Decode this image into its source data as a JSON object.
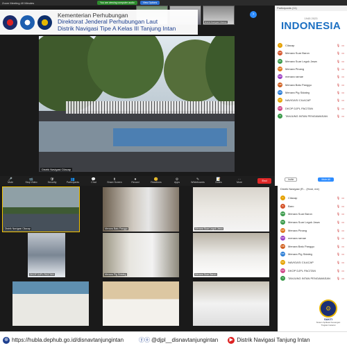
{
  "window": {
    "title": "Zoom Meeting  40 Minutes",
    "recording_label": "You are viewing computer audio",
    "view_label": "View Options"
  },
  "header": {
    "line1": "Kementerian Perhubungan",
    "line2": "Direktorat Jenderal Perhubungan Laut",
    "line3": "Distrik Navigasi Tipe A Kelas III Tanjung Intan"
  },
  "thumbnails": [
    "Distrik Navigasi Tipe",
    "",
    "Distrik Navigasi Cilacap",
    ""
  ],
  "main_video": {
    "label": "Distrik Navigasi Cilacap"
  },
  "panel": {
    "title": "Participants (11)",
    "badge": {
      "dates": "1945          2023",
      "word": "INDONESIA"
    },
    "participants": [
      {
        "name": "Cilacap",
        "color": "#e5a100",
        "initials": "C"
      },
      {
        "name": "Menara Suar Baron",
        "color": "#d4542a",
        "initials": "MS"
      },
      {
        "name": "Menara Suar Legok Jawa",
        "color": "#3a9a4a",
        "initials": "ML"
      },
      {
        "name": "Menara Pinang",
        "color": "#e07820",
        "initials": "MP"
      },
      {
        "name": "menara ramae",
        "color": "#9b3fc4",
        "initials": "MR"
      },
      {
        "name": "Menara Batu Panggu",
        "color": "#d06020",
        "initials": "MB"
      },
      {
        "name": "Menara Pig Sidaleg",
        "color": "#2e7fd6",
        "initials": "MS"
      },
      {
        "name": "NAVIGASI CILACAP",
        "color": "#e6a300",
        "initials": "NC"
      },
      {
        "name": "DKOP DJPL PACITAN",
        "color": "#d14a8a",
        "initials": "DP"
      },
      {
        "name": "TANJUNG INTAN PENGAWASAN",
        "color": "#3a9a4a",
        "initials": "TI"
      }
    ],
    "invite_label": "Invite",
    "mute_all_label": "Mute All"
  },
  "toolbar": {
    "items": [
      {
        "icon": "🎤",
        "label": "Mute"
      },
      {
        "icon": "📹",
        "label": "Stop Video"
      },
      {
        "icon": "🛡",
        "label": "Security"
      },
      {
        "icon": "👥",
        "label": "Participants"
      },
      {
        "icon": "💬",
        "label": "Chat"
      },
      {
        "icon": "⬆",
        "label": "Share Screen"
      },
      {
        "icon": "⏺",
        "label": "Record"
      },
      {
        "icon": "😊",
        "label": "Reactions"
      },
      {
        "icon": "⚙",
        "label": "Apps"
      },
      {
        "icon": "✎",
        "label": "Whiteboards"
      },
      {
        "icon": "📝",
        "label": "Notes"
      },
      {
        "icon": "⋯",
        "label": "More"
      }
    ],
    "end_label": "End"
  },
  "gallery": {
    "tiles": [
      "Distrik Navigasi Cilacap",
      "Menara Batu Panggu",
      "Menara Suar Legok Jawa",
      "DKOP DJPL PACITAN",
      "Menara Pig Sidaleg",
      "Menara Suar Baron",
      "",
      "",
      ""
    ],
    "header": "Distrik Navigasi (R... (Host, me)",
    "participants": [
      {
        "name": "Cilacap",
        "color": "#e5a100",
        "initials": "C"
      },
      {
        "name": "Baro",
        "color": "#d4542a",
        "initials": "B"
      },
      {
        "name": "Menara Suar Baron",
        "color": "#3a9a4a",
        "initials": "MS"
      },
      {
        "name": "Menara Suar Legok Jawa",
        "color": "#3a9a4a",
        "initials": "ML"
      },
      {
        "name": "Menara Pinang",
        "color": "#e07820",
        "initials": "MP"
      },
      {
        "name": "menara ramae",
        "color": "#9b3fc4",
        "initials": "MR"
      },
      {
        "name": "Menara Batu Panggu",
        "color": "#d06020",
        "initials": "MB"
      },
      {
        "name": "Menara Pig Sidaleg",
        "color": "#2e7fd6",
        "initials": "MS"
      },
      {
        "name": "NAVIGASI CILACAP",
        "color": "#e6a300",
        "initials": "NC"
      },
      {
        "name": "DKOP DJPL PACITAN",
        "color": "#d14a8a",
        "initials": "DP"
      },
      {
        "name": "TANJUNG INTAN PENGAWASAN",
        "color": "#3a9a4a",
        "initials": "TI"
      }
    ],
    "sakti_name": "SAKTI",
    "sakti_sub": "Sistem Aplikasi Keuangan Tingkat Instansi"
  },
  "footer": {
    "url": "https://hubla.dephub.go.id/disnavtanjungintan",
    "social": "@djpl__disnavtanjungintan",
    "social_prefix": "ⓨⓞ",
    "channel": "Distrik Navigasi Tanjung Intan"
  }
}
